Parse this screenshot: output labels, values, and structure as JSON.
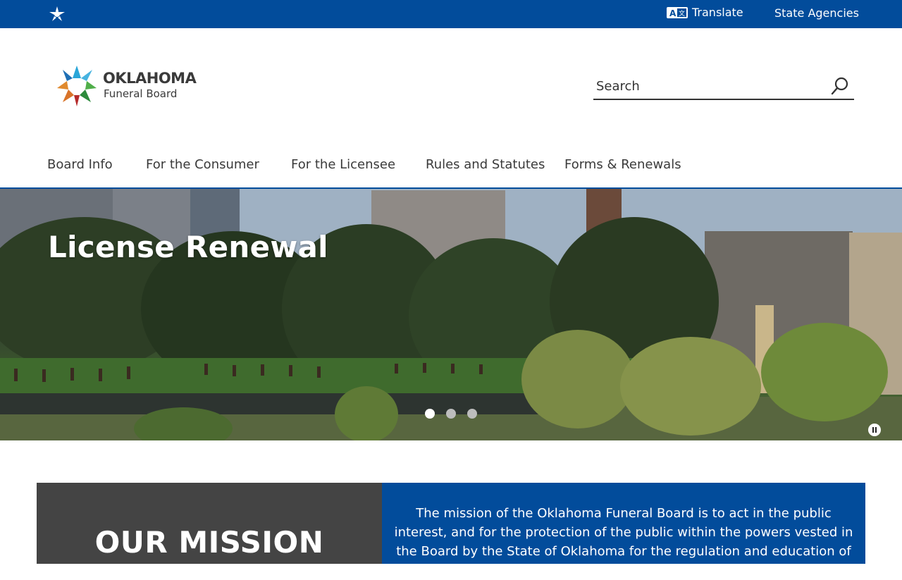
{
  "topbar": {
    "translate_label": "Translate",
    "state_agencies_label": "State Agencies",
    "bg_color": "#024c9b"
  },
  "logo": {
    "line1": "OKLAHOMA",
    "line2": "Funeral Board"
  },
  "search": {
    "placeholder": "Search"
  },
  "nav": {
    "items": [
      {
        "label": "Board Info"
      },
      {
        "label": "For the Consumer"
      },
      {
        "label": "For the Licensee"
      },
      {
        "label": "Rules and Statutes"
      },
      {
        "label": "Forms & Renewals"
      }
    ]
  },
  "hero": {
    "title": "License Renewal",
    "slides_total": 3,
    "active_slide": 1
  },
  "mission": {
    "title": "OUR MISSION",
    "text": "The mission of the Oklahoma Funeral Board is to act in the public interest, and for the protection of the public within the powers vested in the Board by the State of Oklahoma for the regulation and education of the funeral"
  },
  "icons": {
    "top_left": "oklahoma-star-icon",
    "translate": "translate-icon",
    "search": "search-icon",
    "pause": "pause-icon"
  }
}
